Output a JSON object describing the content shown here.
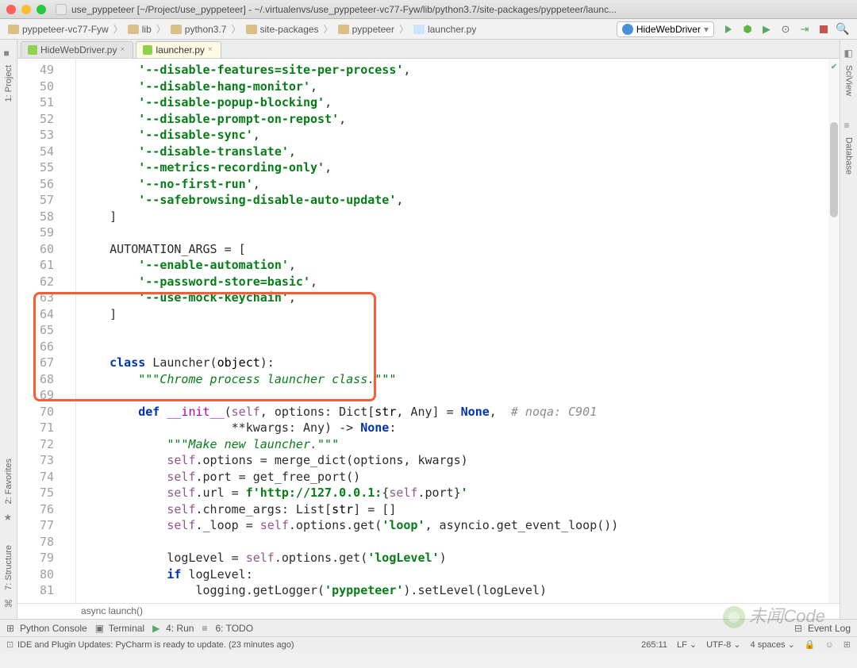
{
  "window": {
    "title": "use_pyppeteer [~/Project/use_pyppeteer] - ~/.virtualenvs/use_pyppeteer-vc77-Fyw/lib/python3.7/site-packages/pyppeteer/launc..."
  },
  "breadcrumb": {
    "items": [
      "pyppeteer-vc77-Fyw",
      "lib",
      "python3.7",
      "site-packages",
      "pyppeteer",
      "launcher.py"
    ]
  },
  "run_config": "HideWebDriver",
  "sidebars": {
    "left": [
      {
        "label": "1: Project",
        "icon": "■"
      },
      {
        "label": "2: Favorites",
        "icon": "★"
      },
      {
        "label": "7: Structure",
        "icon": "⌘"
      }
    ],
    "right": [
      {
        "label": "SciView",
        "icon": "◧"
      },
      {
        "label": "Database",
        "icon": "≡"
      }
    ]
  },
  "tabs": [
    {
      "label": "HideWebDriver.py",
      "active": false
    },
    {
      "label": "launcher.py",
      "active": true
    }
  ],
  "lines": {
    "start": 49,
    "end": 81
  },
  "code": {
    "l49": "'--disable-features=site-per-process'",
    "l50": "'--disable-hang-monitor'",
    "l51": "'--disable-popup-blocking'",
    "l52": "'--disable-prompt-on-repost'",
    "l53": "'--disable-sync'",
    "l54": "'--disable-translate'",
    "l55": "'--metrics-recording-only'",
    "l56": "'--no-first-run'",
    "l57": "'--safebrowsing-disable-auto-update'",
    "l60a": "AUTOMATION_ARGS = [",
    "l61": "'--enable-automation'",
    "l62": "'--password-store=basic'",
    "l63": "'--use-mock-keychain'",
    "l67_cls": "class",
    "l67_name": " Launcher(",
    "l67_obj": "object",
    "l67_end": "):",
    "l68_doc": "\"\"\"Chrome process launcher class.\"\"\"",
    "l70_def": "def ",
    "l70_init": "__init__",
    "l70_sig1": "(",
    "l70_self": "self",
    "l70_sig2": ", options: Dict[",
    "l70_str": "str",
    "l70_sig3": ", Any] = ",
    "l70_none": "None",
    "l70_sig4": ",  ",
    "l70_cm": "# noqa: C901",
    "l71_sig": "             **kwargs: Any) -> ",
    "l71_none": "None",
    "l71_end": ":",
    "l72_doc": "\"\"\"Make new launcher.\"\"\"",
    "l73_self": "self",
    "l73_rest": ".options = merge_dict(options, kwargs)",
    "l74_self": "self",
    "l74_rest": ".port = get_free_port()",
    "l75_self": "self",
    "l75_a": ".url = ",
    "l75_f": "f'http://127.0.0.1:",
    "l75_b": "{",
    "l75_self2": "self",
    "l75_c": ".port}",
    "l75_q": "'",
    "l76_self": "self",
    "l76_rest": ".chrome_args: List[",
    "l76_str": "str",
    "l76_end": "] = []",
    "l77_self": "self",
    "l77_a": "._loop = ",
    "l77_self2": "self",
    "l77_b": ".options.get(",
    "l77_s": "'loop'",
    "l77_c": ", asyncio.get_event_loop())",
    "l79_a": "logLevel = ",
    "l79_self": "self",
    "l79_b": ".options.get(",
    "l79_s": "'logLevel'",
    "l79_c": ")",
    "l80_if": "if",
    "l80_rest": " logLevel:",
    "l81_a": "    logging.getLogger(",
    "l81_s": "'pyppeteer'",
    "l81_b": ").setLevel(logLevel)"
  },
  "foot_crumb": "async launch()",
  "bottom": {
    "console": "Python Console",
    "terminal": "Terminal",
    "run": "4: Run",
    "todo": "6: TODO",
    "eventlog": "Event Log"
  },
  "status": {
    "message": "IDE and Plugin Updates: PyCharm is ready to update. (23 minutes ago)",
    "pos": "265:11",
    "lf": "LF",
    "enc": "UTF-8",
    "indent": "4 spaces"
  },
  "watermark": "未闻Code"
}
